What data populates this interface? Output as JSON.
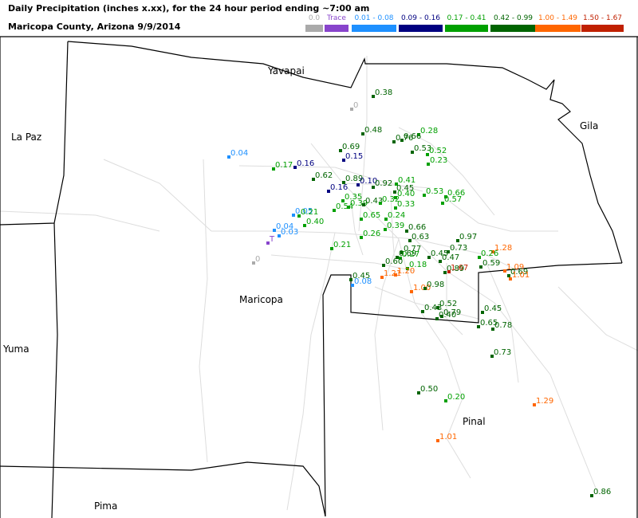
{
  "title": {
    "line1": "Daily Precipitation (inches  x.xx),  for the 24 hour period ending ~7:00 am",
    "line2": "Maricopa County, Arizona  9/9/2014"
  },
  "legend": [
    {
      "label": "0.0",
      "color": "#aaaaaa"
    },
    {
      "label": "Trace",
      "color": "#8844cc"
    },
    {
      "label": "0.01 - 0.08",
      "color": "#1e90ff"
    },
    {
      "label": "0.09 - 0.16",
      "color": "#000080"
    },
    {
      "label": "0.17 - 0.41",
      "color": "#00a000"
    },
    {
      "label": "0.42 - 0.99",
      "color": "#006400"
    },
    {
      "label": "1.00 - 1.49",
      "color": "#ff6600"
    },
    {
      "label": "1.50 - 1.67",
      "color": "#c02000"
    }
  ],
  "counties": [
    {
      "id": "yavapai",
      "label": "Yavapai"
    },
    {
      "id": "gila",
      "label": "Gila"
    },
    {
      "id": "lapaz",
      "label": "La Paz"
    },
    {
      "id": "maricopa",
      "label": "Maricopa"
    },
    {
      "id": "yuma",
      "label": "Yuma"
    },
    {
      "id": "pinal",
      "label": "Pinal"
    },
    {
      "id": "pima",
      "label": "Pima"
    }
  ],
  "stations": [
    {
      "v": "0.38",
      "c": 5
    },
    {
      "v": "0",
      "c": 0
    },
    {
      "v": "0.48",
      "c": 5
    },
    {
      "v": "0.28",
      "c": 4
    },
    {
      "v": "0.76",
      "c": 5
    },
    {
      "v": "0.66",
      "c": 5
    },
    {
      "v": "0.53",
      "c": 5
    },
    {
      "v": "0.52",
      "c": 4
    },
    {
      "v": "0.23",
      "c": 4
    },
    {
      "v": "0.69",
      "c": 5
    },
    {
      "v": "0.15",
      "c": 3
    },
    {
      "v": "0.04",
      "c": 2
    },
    {
      "v": "0.17",
      "c": 4
    },
    {
      "v": "0.16",
      "c": 3
    },
    {
      "v": "0.62",
      "c": 5
    },
    {
      "v": "0.89",
      "c": 5
    },
    {
      "v": "0.10",
      "c": 3
    },
    {
      "v": "0.92",
      "c": 5
    },
    {
      "v": "0.41",
      "c": 4
    },
    {
      "v": "0.16",
      "c": 3
    },
    {
      "v": "0.45",
      "c": 5
    },
    {
      "v": "0.40",
      "c": 4
    },
    {
      "v": "0.53",
      "c": 4
    },
    {
      "v": "0.66",
      "c": 4
    },
    {
      "v": "0.57",
      "c": 4
    },
    {
      "v": "0.35",
      "c": 4
    },
    {
      "v": "0.39",
      "c": 4
    },
    {
      "v": "0.54",
      "c": 4
    },
    {
      "v": "0.43",
      "c": 5
    },
    {
      "v": "0.32",
      "c": 4
    },
    {
      "v": "0.33",
      "c": 4
    },
    {
      "v": "0.05",
      "c": 2
    },
    {
      "v": "0.21",
      "c": 4
    },
    {
      "v": "0.24",
      "c": 4
    },
    {
      "v": "0.40",
      "c": 4
    },
    {
      "v": "0.65",
      "c": 4
    },
    {
      "v": "0.39",
      "c": 4
    },
    {
      "v": "0.26",
      "c": 4
    },
    {
      "v": "0.66",
      "c": 5
    },
    {
      "v": "0.04",
      "c": 2
    },
    {
      "v": "0.03",
      "c": 2
    },
    {
      "v": "0.63",
      "c": 5
    },
    {
      "v": "0.97",
      "c": 5
    },
    {
      "v": "T",
      "c": 1
    },
    {
      "v": "0",
      "c": 0
    },
    {
      "v": "0.21",
      "c": 4
    },
    {
      "v": "0.77",
      "c": 5
    },
    {
      "v": "0.69",
      "c": 5
    },
    {
      "v": "0.45",
      "c": 5
    },
    {
      "v": "0.73",
      "c": 5
    },
    {
      "v": "0.47",
      "c": 5
    },
    {
      "v": "1.28",
      "c": 6
    },
    {
      "v": "0.26",
      "c": 4
    },
    {
      "v": "0.27",
      "c": 4
    },
    {
      "v": "0.60",
      "c": 5
    },
    {
      "v": "0.59",
      "c": 5
    },
    {
      "v": "0.18",
      "c": 4
    },
    {
      "v": "1.21",
      "c": 6
    },
    {
      "v": "1.20",
      "c": 6
    },
    {
      "v": "0.89",
      "c": 5
    },
    {
      "v": "1.67",
      "c": 7
    },
    {
      "v": "1.09",
      "c": 6
    },
    {
      "v": "0.69",
      "c": 5
    },
    {
      "v": "1.01",
      "c": 6
    },
    {
      "v": "0.45",
      "c": 5
    },
    {
      "v": "0.08",
      "c": 2
    },
    {
      "v": "1.00",
      "c": 6
    },
    {
      "v": "0.98",
      "c": 5
    },
    {
      "v": "0.52",
      "c": 5
    },
    {
      "v": "0.43",
      "c": 5
    },
    {
      "v": "0.79",
      "c": 5
    },
    {
      "v": "0.40",
      "c": 5
    },
    {
      "v": "0.45",
      "c": 5
    },
    {
      "v": "0.65",
      "c": 5
    },
    {
      "v": "0.78",
      "c": 5
    },
    {
      "v": "0.73",
      "c": 5
    },
    {
      "v": "0.50",
      "c": 5
    },
    {
      "v": "0.20",
      "c": 4
    },
    {
      "v": "1.29",
      "c": 6
    },
    {
      "v": "1.01",
      "c": 6
    },
    {
      "v": "0.86",
      "c": 5
    }
  ]
}
